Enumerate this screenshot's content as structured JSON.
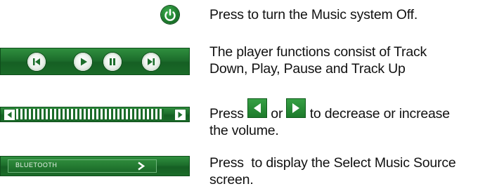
{
  "rows": [
    {
      "description": "Press to turn the Music system Off.",
      "icon": "power-icon"
    },
    {
      "line1": "The player functions consist of Track",
      "line2": "Down, Play, Pause and Track Up",
      "controls": [
        "track-down-icon",
        "play-icon",
        "pause-icon",
        "track-up-icon"
      ]
    },
    {
      "press": "Press",
      "or": "or",
      "to_text": "to decrease or increase",
      "line2": "the volume.",
      "icons": [
        "volume-down-arrow-icon",
        "volume-up-arrow-icon"
      ]
    },
    {
      "line1": "Press  to display the Select Music Source",
      "line2": "screen.",
      "button_label": "BLUETOOTH"
    }
  ],
  "colors": {
    "panel_green": "#1d6e2c",
    "icon_green": "#2f8f3e",
    "text": "#111111"
  }
}
